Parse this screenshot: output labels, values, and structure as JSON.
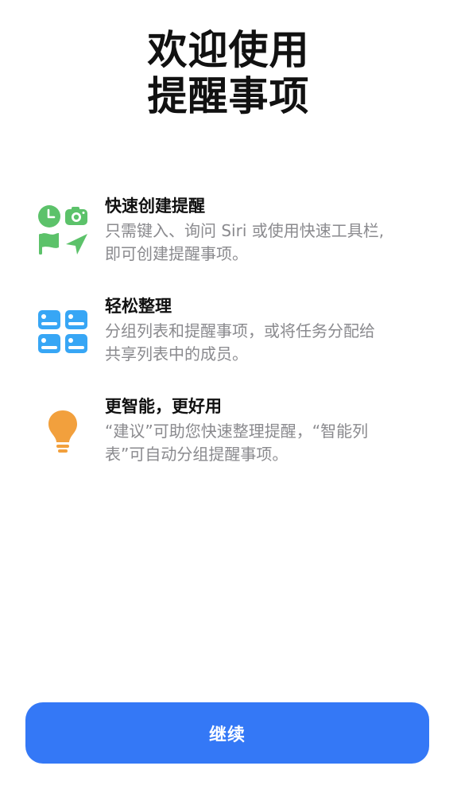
{
  "title": {
    "line1": "欢迎使用",
    "line2": "提醒事项"
  },
  "features": [
    {
      "icon": "quick-create-icons",
      "heading": "快速创建提醒",
      "desc_line1": "只需键入、询问 Siri 或使用快速工具栏,",
      "desc_line2": "即可创建提醒事项。"
    },
    {
      "icon": "lists-grid-icon",
      "heading": "轻松整理",
      "desc_line1": "分组列表和提醒事项，或将任务分配给",
      "desc_line2": "共享列表中的成员。"
    },
    {
      "icon": "lightbulb-icon",
      "heading": "更智能，更好用",
      "desc_line1": "“建议”可助您快速整理提醒，“智能列",
      "desc_line2": "表”可自动分组提醒事项。"
    }
  ],
  "continue_button": {
    "label": "继续"
  },
  "colors": {
    "green": "#5cc26a",
    "blue_icon": "#37a6f5",
    "orange": "#f2a03d",
    "button_blue": "#3478f6",
    "desc_gray": "#8a8a8e"
  }
}
